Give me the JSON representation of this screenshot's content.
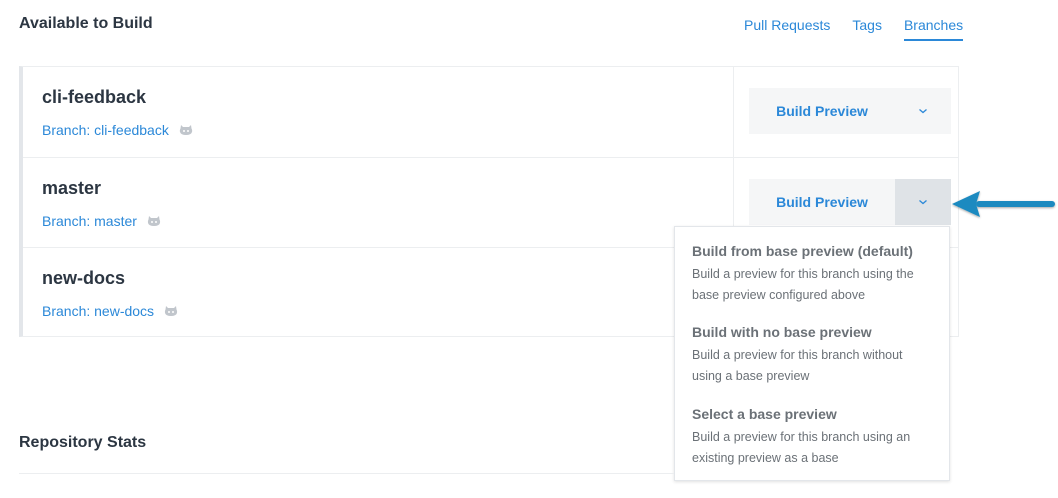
{
  "header": {
    "title": "Available to Build",
    "tabs": [
      {
        "label": "Pull Requests",
        "active": false
      },
      {
        "label": "Tags",
        "active": false
      },
      {
        "label": "Branches",
        "active": true
      }
    ]
  },
  "rows": [
    {
      "name": "cli-feedback",
      "branch": "Branch: cli-feedback",
      "button": "Build Preview"
    },
    {
      "name": "master",
      "branch": "Branch: master",
      "button": "Build Preview"
    },
    {
      "name": "new-docs",
      "branch": "Branch: new-docs"
    }
  ],
  "dropdown": {
    "items": [
      {
        "title": "Build from base preview (default)",
        "desc_line1": "Build a preview for this branch using the",
        "desc_line2": "base preview configured above"
      },
      {
        "title": "Build with no base preview",
        "desc_line1": "Build a preview for this branch without",
        "desc_line2": "using a base preview"
      },
      {
        "title": "Select a base preview",
        "desc_line1": "Build a preview for this branch using an",
        "desc_line2": "existing preview as a base"
      }
    ]
  },
  "stats": {
    "title": "Repository Stats"
  },
  "colors": {
    "accent": "#2b88d8",
    "arrow": "#1b8ac0",
    "text": "#2c3642",
    "muted": "#6b7177"
  },
  "icons": {
    "branch_icon": "github-octocat-icon",
    "caret": "chevron-down-icon",
    "callout": "arrow-left-icon"
  }
}
